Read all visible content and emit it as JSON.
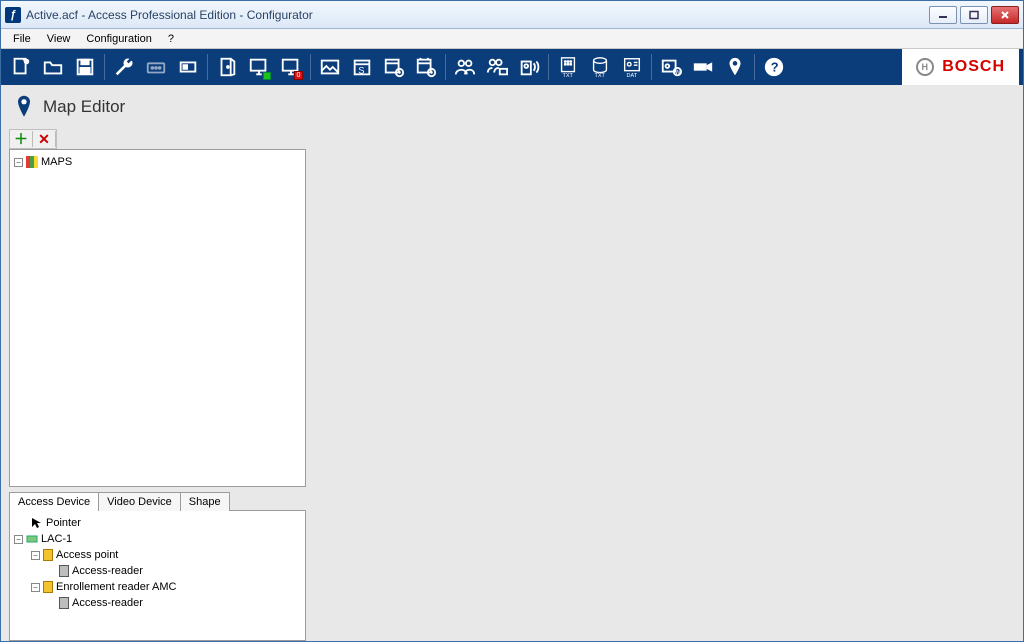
{
  "window": {
    "title": "Active.acf - Access Professional Edition - Configurator"
  },
  "menu": {
    "file": "File",
    "view": "View",
    "config": "Configuration",
    "help": "?"
  },
  "brand": "BOSCH",
  "section": {
    "title": "Map Editor"
  },
  "maps_tree": {
    "root": "MAPS"
  },
  "tabs": {
    "access": "Access Device",
    "video": "Video Device",
    "shape": "Shape"
  },
  "devices": {
    "pointer": "Pointer",
    "lac": "LAC-1",
    "ap": "Access point",
    "ar1": "Access-reader",
    "er": "Enrollement reader AMC",
    "ar2": "Access-reader"
  },
  "toolbar_badge": "0"
}
